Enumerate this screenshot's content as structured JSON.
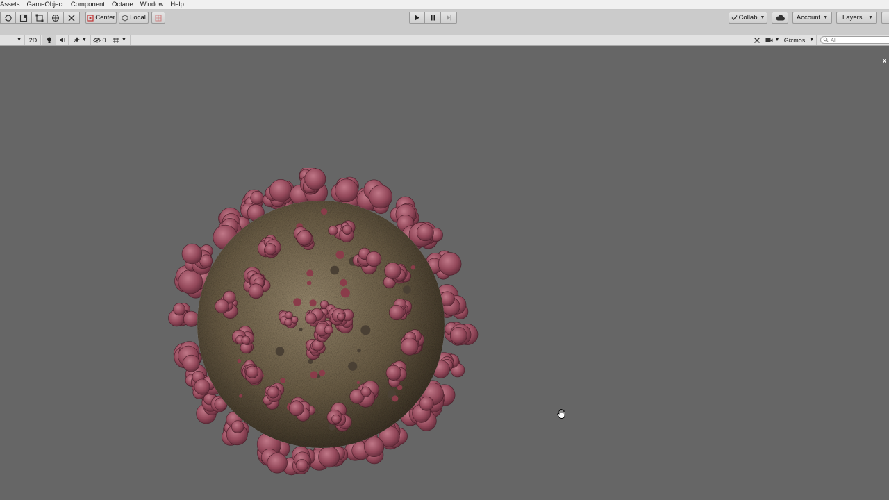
{
  "menu": [
    "Assets",
    "GameObject",
    "Component",
    "Octane",
    "Window",
    "Help"
  ],
  "toolbar": {
    "pivot_label": "Center",
    "space_label": "Local",
    "collab_label": "Collab",
    "account_label": "Account",
    "layers_label": "Layers"
  },
  "scene_toolbar": {
    "mode_2d_label": "2D",
    "hidden_count": "0",
    "gizmos_label": "Gizmos",
    "search_placeholder": "All"
  },
  "viewport": {
    "close_label": "x",
    "background_color": "#666666",
    "virus_spike_color": "#9a4a5e",
    "virus_body_color": "#7d6d55"
  }
}
